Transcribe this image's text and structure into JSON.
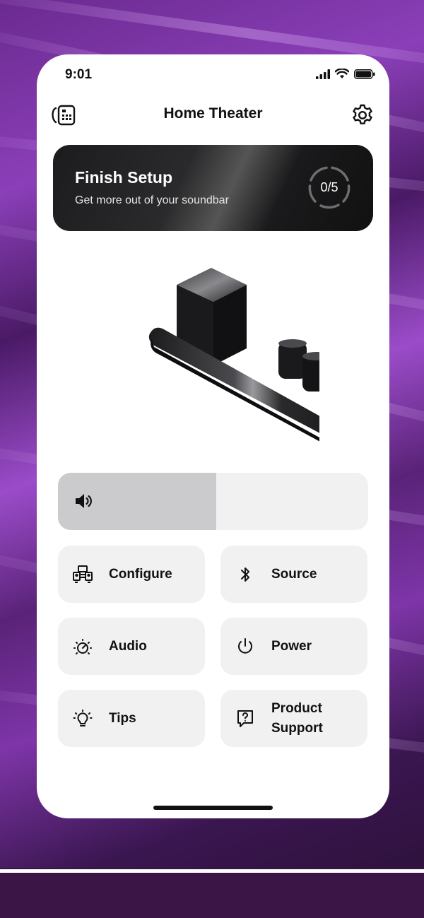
{
  "status_bar": {
    "time": "9:01"
  },
  "header": {
    "title": "Home Theater",
    "left_icon": "remote-icon",
    "right_icon": "gear-icon"
  },
  "setup_card": {
    "title": "Finish Setup",
    "subtitle": "Get more out of your soundbar",
    "progress_label": "0/5",
    "completed": 0,
    "total": 5
  },
  "product_image": {
    "name": "soundbar-with-subwoofer-and-rear-speakers"
  },
  "volume": {
    "icon": "speaker-volume-icon",
    "level": 0.51
  },
  "tiles": [
    {
      "label": "Configure",
      "icon": "configure-icon"
    },
    {
      "label": "Source",
      "icon": "bluetooth-icon"
    },
    {
      "label": "Audio",
      "icon": "audio-dial-icon"
    },
    {
      "label": "Power",
      "icon": "power-icon"
    },
    {
      "label": "Tips",
      "icon": "lightbulb-icon"
    },
    {
      "label": "Product Support",
      "label_line1": "Product",
      "label_line2": "Support",
      "icon": "help-chat-icon"
    }
  ],
  "colors": {
    "background_accent": "#8b3fb8",
    "card_dark": "#1c1c1e",
    "tile_bg": "#f1f1f2",
    "volume_fill": "#cbcbce"
  }
}
